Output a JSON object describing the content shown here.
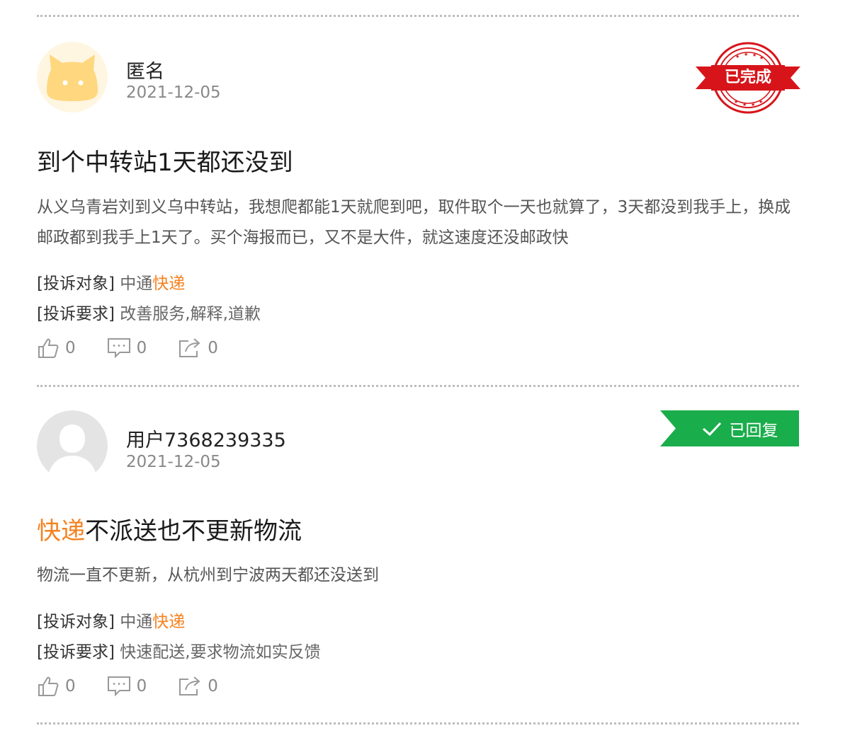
{
  "posts": [
    {
      "username": "匿名",
      "date": "2021-12-05",
      "status": "已完成",
      "title_parts": {
        "plain": "到个中转站1天都还没到"
      },
      "content": "从义乌青岩刘到义乌中转站，我想爬都能1天就爬到吧，取件取个一天也就算了，3天都没到我手上，换成邮政都到我手上1天了。买个海报而已，又不是大件，就这速度还没邮政快",
      "target_label": "[投诉对象]",
      "target_company": "中通",
      "target_highlight": "快递",
      "request_label": "[投诉要求]",
      "request_value": "改善服务,解释,道歉",
      "likes": "0",
      "comments": "0",
      "shares": "0"
    },
    {
      "username": "用户7368239335",
      "date": "2021-12-05",
      "status": "已回复",
      "title_parts": {
        "highlight": "快递",
        "plain": "不派送也不更新物流"
      },
      "content": "物流一直不更新，从杭州到宁波两天都还没送到",
      "target_label": "[投诉对象]",
      "target_company": "中通",
      "target_highlight": "快递",
      "request_label": "[投诉要求]",
      "request_value": "快速配送,要求物流如实反馈",
      "likes": "0",
      "comments": "0",
      "shares": "0"
    }
  ],
  "colors": {
    "highlight": "#f58220",
    "stamp_red": "#d7141a",
    "replied_green": "#1aad4b",
    "divider": "#bdbdbd"
  },
  "icons": [
    "cat-avatar-icon",
    "default-user-avatar-icon",
    "thumbs-up-icon",
    "comment-icon",
    "share-icon",
    "completed-stamp",
    "check-icon"
  ]
}
